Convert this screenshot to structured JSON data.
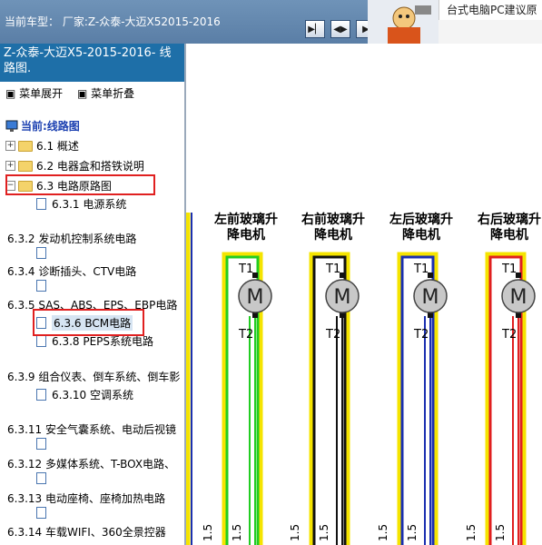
{
  "header": {
    "car_label": "当前车型：  厂家:Z-众泰-大迈X52015-2016",
    "nav_buttons": [
      "prev",
      "next",
      "play"
    ],
    "ad_text": "台式电脑PC建议原"
  },
  "sidebar": {
    "title": "Z-众泰-大迈X5-2015-2016- 线路图.",
    "menu_expand": "菜单展开",
    "menu_collapse": "菜单折叠",
    "current": "当前:线路图",
    "items": [
      {
        "label": "6.1 概述",
        "kind": "folder"
      },
      {
        "label": "6.2 电器盒和搭铁说明",
        "kind": "folder"
      },
      {
        "label": "6.3 电路原路图",
        "kind": "folder",
        "highlighted": true
      },
      {
        "label": "6.3.1 电源系统",
        "kind": "doc"
      },
      {
        "label": "6.3.2 发动机控制系统电路",
        "kind": "group"
      },
      {
        "label": "",
        "kind": "doc"
      },
      {
        "label": "6.3.4 诊断插头、CTV电路",
        "kind": "group"
      },
      {
        "label": "",
        "kind": "doc"
      },
      {
        "label": "6.3.5 SAS、ABS、EPS、EBP电路",
        "kind": "group"
      },
      {
        "label": "6.3.6 BCM电路",
        "kind": "doc",
        "selected": true,
        "highlighted": true
      },
      {
        "label": "6.3.8 PEPS系统电路",
        "kind": "doc"
      },
      {
        "label": "6.3.9 组合仪表、倒车系统、倒车影",
        "kind": "group"
      },
      {
        "label": "6.3.10 空调系统",
        "kind": "doc"
      },
      {
        "label": "6.3.11 安全气囊系统、电动后视镜",
        "kind": "group"
      },
      {
        "label": "",
        "kind": "doc"
      },
      {
        "label": "6.3.12 多媒体系统、T-BOX电路、",
        "kind": "group"
      },
      {
        "label": "",
        "kind": "doc"
      },
      {
        "label": "6.3.13 电动座椅、座椅加热电路",
        "kind": "group"
      },
      {
        "label": "",
        "kind": "doc"
      },
      {
        "label": "6.3.14 车载WIFI、360全景控器",
        "kind": "group"
      }
    ]
  },
  "diagram": {
    "motors": [
      {
        "name": "左前玻璃升降电机",
        "color": "#22cc22",
        "t1": "T1",
        "t2": "T2",
        "glyph": "M",
        "wire": "1.5"
      },
      {
        "name": "右前玻璃升降电机",
        "color": "#111111",
        "t1": "T1",
        "t2": "T2",
        "glyph": "M",
        "wire": "1.5"
      },
      {
        "name": "左后玻璃升降电机",
        "color": "#1a2fb0",
        "t1": "T1",
        "t2": "T2",
        "glyph": "M",
        "wire": "1.5"
      },
      {
        "name": "右后玻璃升降电机",
        "color": "#e02020",
        "t1": "T1",
        "t2": "T2",
        "glyph": "M",
        "wire": "1.5"
      }
    ],
    "border_color": "#f5e400"
  }
}
